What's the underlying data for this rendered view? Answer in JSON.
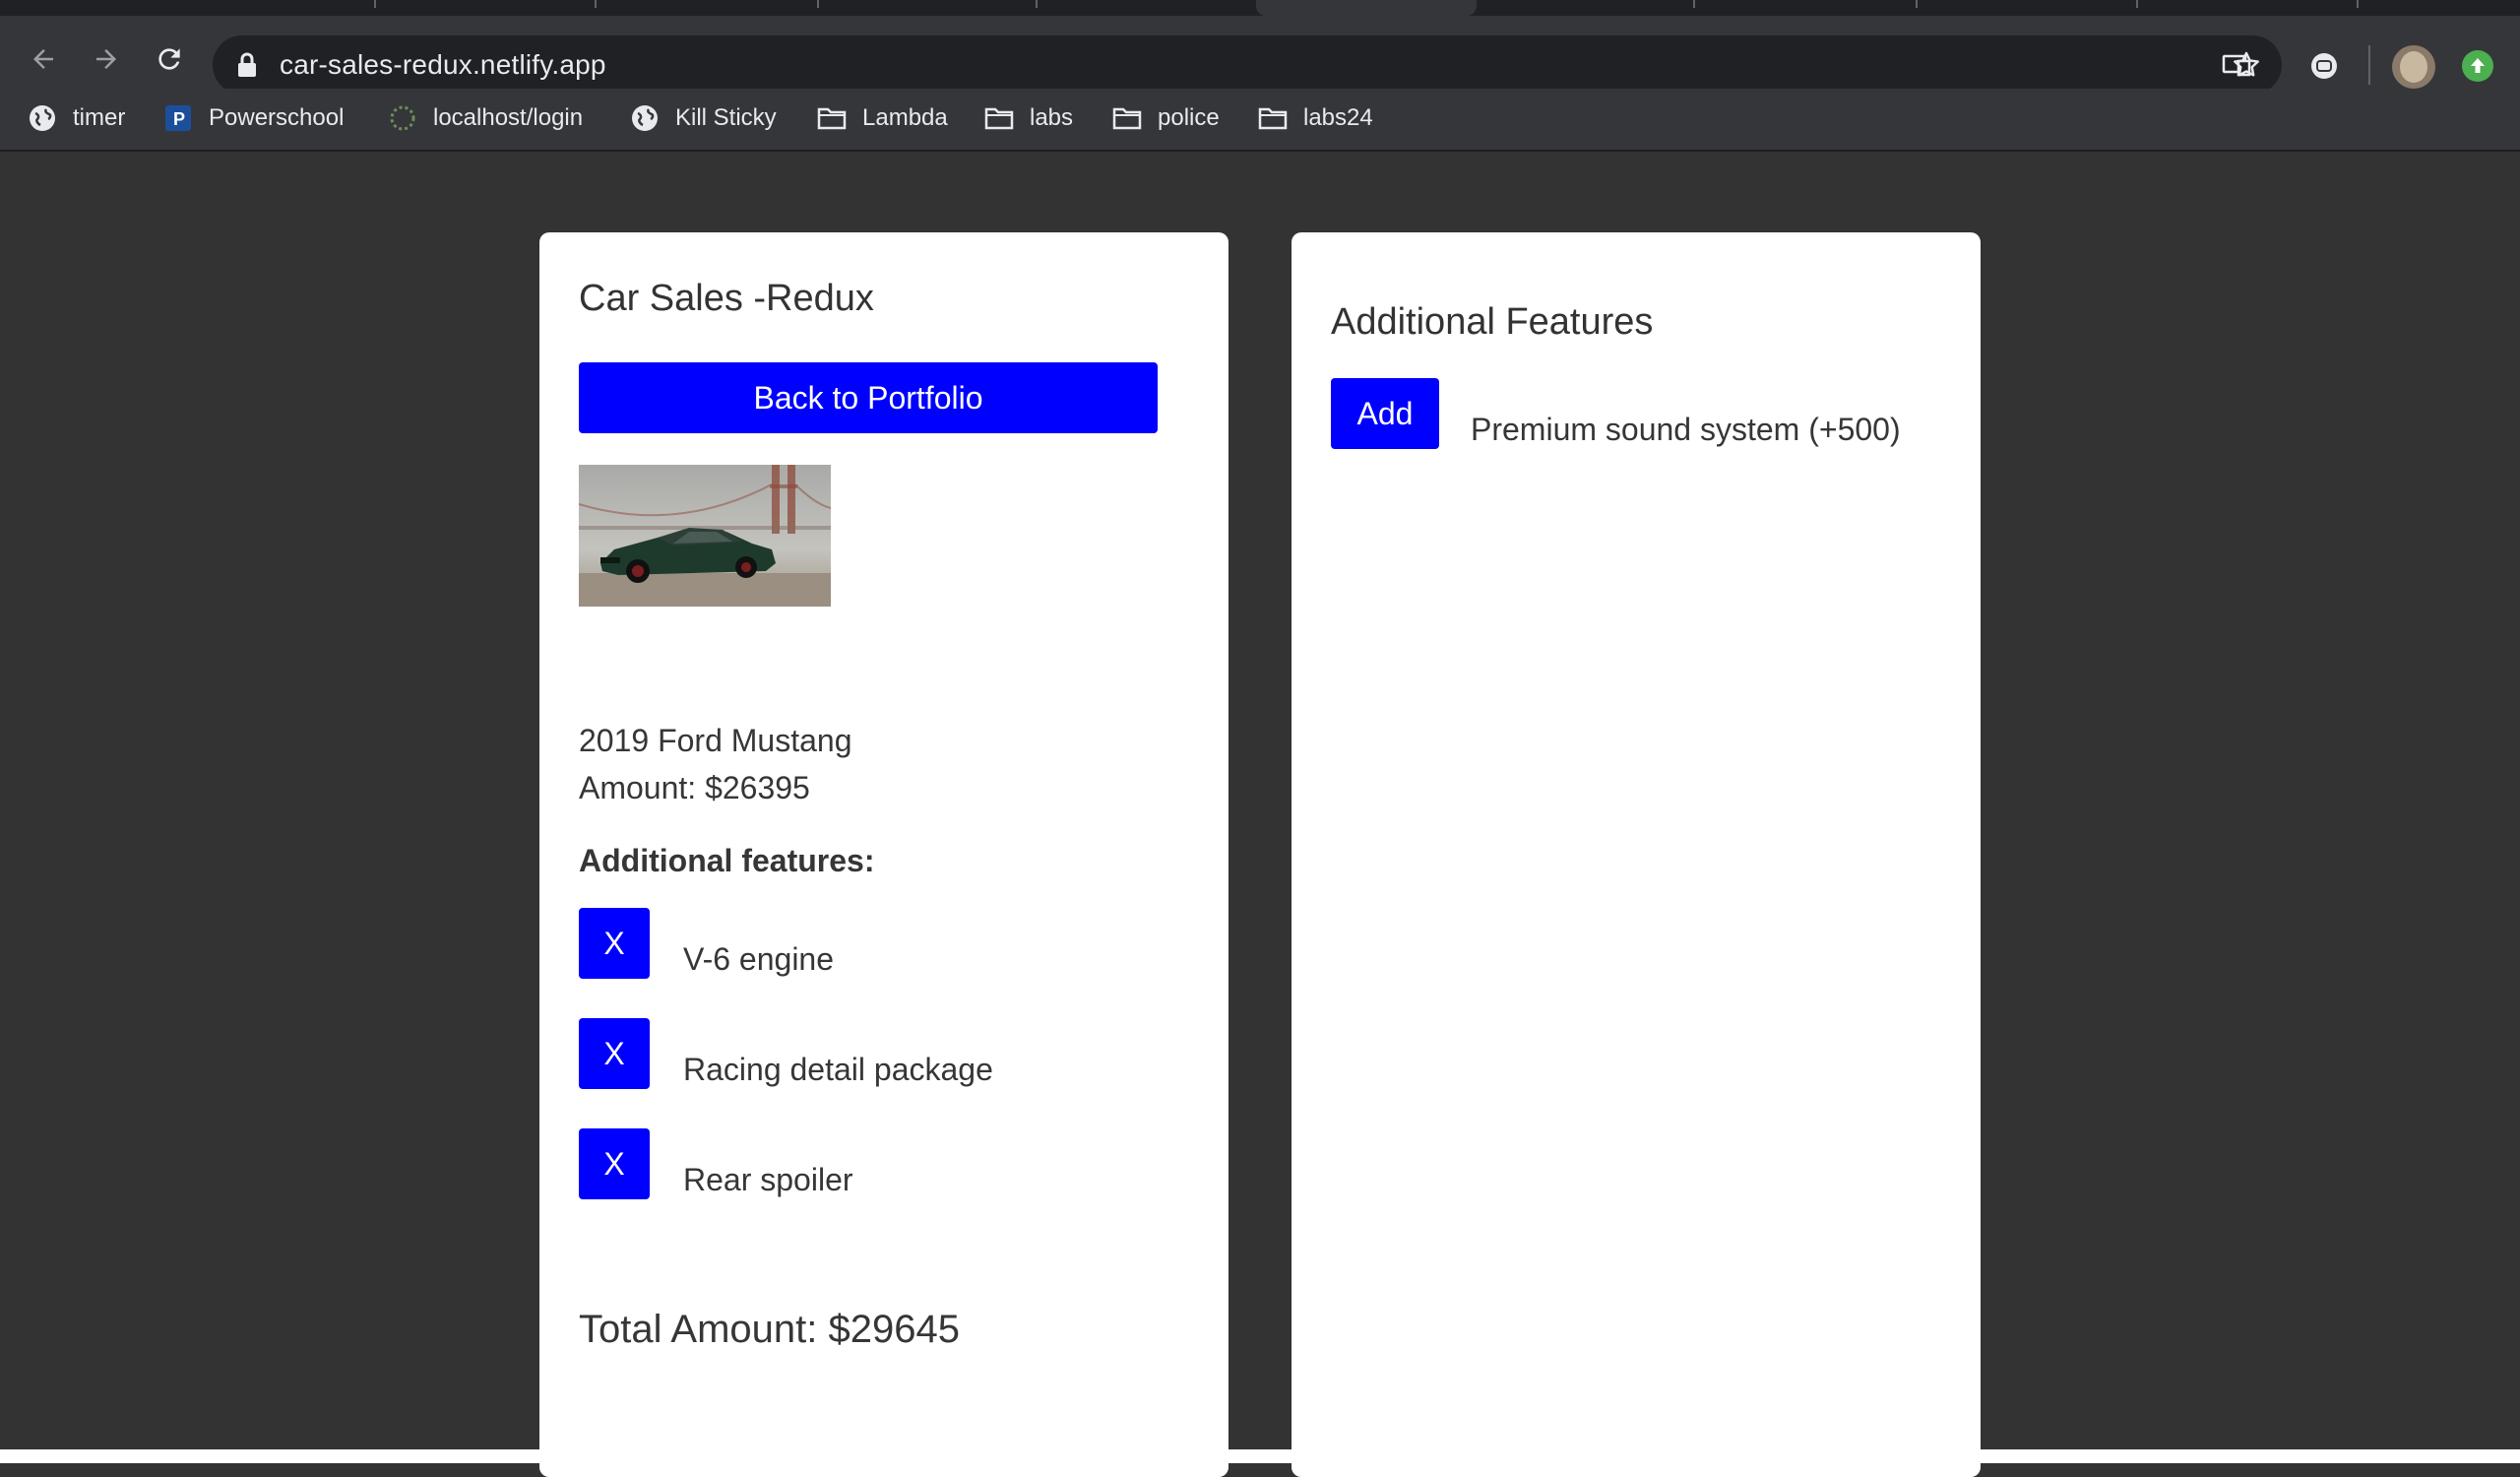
{
  "browser": {
    "url": "car-sales-redux.netlify.app",
    "bookmarks": [
      {
        "label": "timer",
        "icon": "globe-icon"
      },
      {
        "label": "Powerschool",
        "icon": "powerschool-icon"
      },
      {
        "label": "localhost/login",
        "icon": "spinner-icon"
      },
      {
        "label": "Kill Sticky",
        "icon": "globe-icon"
      },
      {
        "label": "Lambda",
        "icon": "folder-icon"
      },
      {
        "label": "labs",
        "icon": "folder-icon"
      },
      {
        "label": "police",
        "icon": "folder-icon"
      },
      {
        "label": "labs24",
        "icon": "folder-icon"
      }
    ]
  },
  "left_card": {
    "title": "Car Sales -Redux",
    "portfolio_button": "Back to Portfolio",
    "car_image_alt": "car photo",
    "car_name": "2019 Ford Mustang",
    "amount": "Amount: $26395",
    "features_heading": "Additional features:",
    "features": [
      {
        "remove_label": "X",
        "name": "V-6 engine"
      },
      {
        "remove_label": "X",
        "name": "Racing detail package"
      },
      {
        "remove_label": "X",
        "name": "Rear spoiler"
      }
    ],
    "total": "Total Amount: $29645"
  },
  "right_card": {
    "title": "Additional Features",
    "items": [
      {
        "add_label": "Add",
        "name": "Premium sound system (+500)"
      }
    ]
  },
  "colors": {
    "accent": "#0000ff",
    "page_background": "#333334",
    "card_background": "#ffffff"
  }
}
